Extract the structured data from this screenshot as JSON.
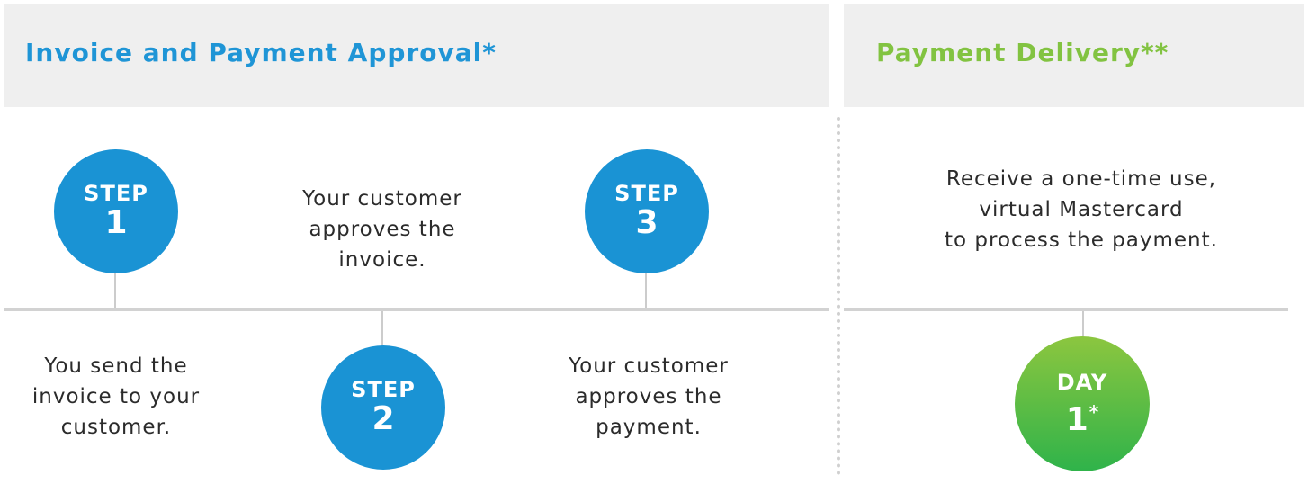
{
  "headers": {
    "approval_title": "Invoice and Payment Approval*",
    "delivery_title": "Payment Delivery**"
  },
  "steps": [
    {
      "word": "STEP",
      "number": "1",
      "text_lines": [
        "You send the",
        "invoice to your",
        "customer."
      ]
    },
    {
      "word": "STEP",
      "number": "2",
      "text_lines": [
        "Your customer",
        "approves the",
        "invoice."
      ]
    },
    {
      "word": "STEP",
      "number": "3",
      "text_lines": [
        "Your customer",
        "approves the",
        "payment."
      ]
    }
  ],
  "delivery": {
    "word": "DAY",
    "number": "1",
    "marker": "*",
    "text_lines": [
      "Receive a one-time use,",
      "virtual Mastercard",
      "to process the payment."
    ]
  },
  "colors": {
    "approval_blue": "#1f95d6",
    "delivery_green": "#82c341",
    "header_band": "#efefef"
  }
}
